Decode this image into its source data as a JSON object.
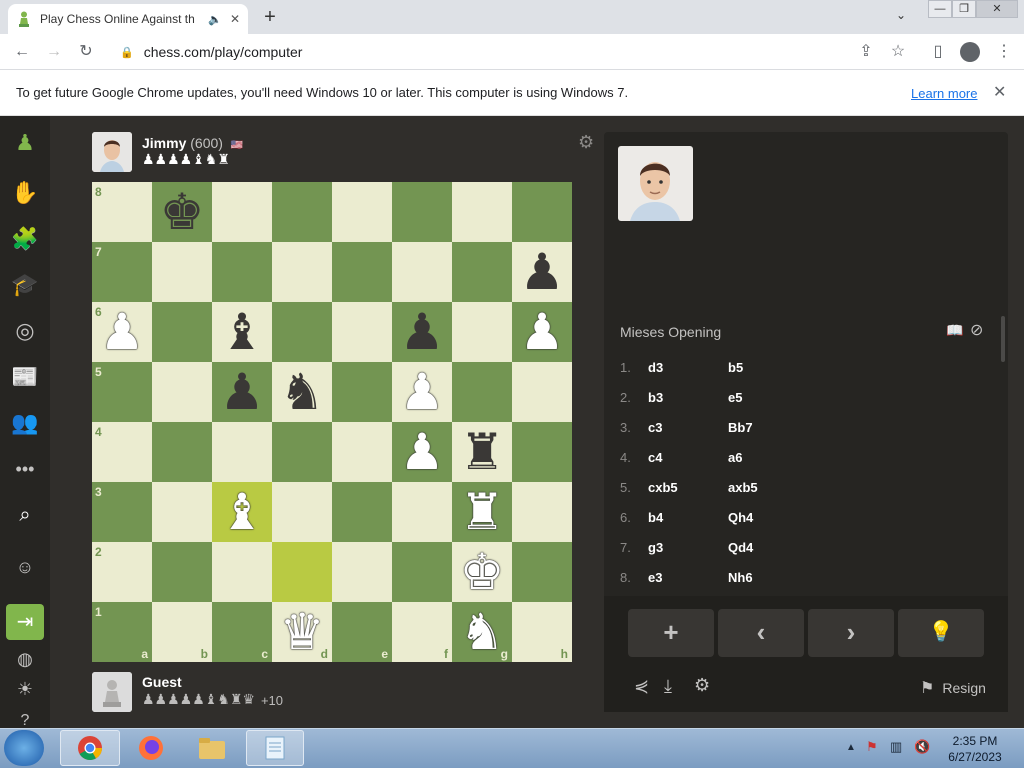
{
  "browser": {
    "tab_title": "Play Chess Online Against th",
    "sound_icon": "speaker-icon",
    "url": "chess.com/play/computer",
    "window_min": "—",
    "window_restore": "❐",
    "window_close": "✕"
  },
  "infobar": {
    "message": "To get future Google Chrome updates, you'll need Windows 10 or later. This computer is using Windows 7.",
    "learn_more": "Learn more"
  },
  "opponent": {
    "name": "Jimmy",
    "rating": "(600)",
    "captured": "♟♟♟♟♝♞♜"
  },
  "player": {
    "name": "Guest",
    "captured": "♟♟♟♟♟♝♞♜♛",
    "advantage": "+10"
  },
  "board": {
    "ranks": [
      "8",
      "7",
      "6",
      "5",
      "4",
      "3",
      "2",
      "1"
    ],
    "files": [
      "a",
      "b",
      "c",
      "d",
      "e",
      "f",
      "g",
      "h"
    ],
    "rows": [
      [
        "",
        "k",
        "",
        "",
        "",
        "",
        "",
        ""
      ],
      [
        "",
        "",
        "",
        "",
        "",
        "",
        "",
        "p"
      ],
      [
        "P",
        "",
        "b",
        "",
        "",
        "p",
        "",
        "P"
      ],
      [
        "",
        "",
        "p",
        "n",
        "",
        "P",
        "",
        ""
      ],
      [
        "",
        "",
        "",
        "",
        "",
        "P",
        "r",
        ""
      ],
      [
        "",
        "",
        "B",
        "",
        "",
        "",
        "R",
        ""
      ],
      [
        "",
        "",
        "",
        "",
        "",
        "",
        "K",
        ""
      ],
      [
        "",
        "",
        "",
        "Q",
        "",
        "",
        "N",
        ""
      ]
    ],
    "highlights": [
      "c3",
      "d2"
    ]
  },
  "panel": {
    "opening": "Mieses Opening",
    "moves": [
      {
        "num": "1.",
        "white": "d3",
        "black": "b5"
      },
      {
        "num": "2.",
        "white": "b3",
        "black": "e5"
      },
      {
        "num": "3.",
        "white": "c3",
        "black": "Bb7"
      },
      {
        "num": "4.",
        "white": "c4",
        "black": "a6"
      },
      {
        "num": "5.",
        "white": "cxb5",
        "black": "axb5"
      },
      {
        "num": "6.",
        "white": "b4",
        "black": "Qh4"
      },
      {
        "num": "7.",
        "white": "g3",
        "black": "Qd4"
      },
      {
        "num": "8.",
        "white": "e3",
        "black": "Nh6"
      }
    ],
    "resign": "Resign"
  },
  "taskbar": {
    "time": "2:35 PM",
    "date": "6/27/2023"
  }
}
